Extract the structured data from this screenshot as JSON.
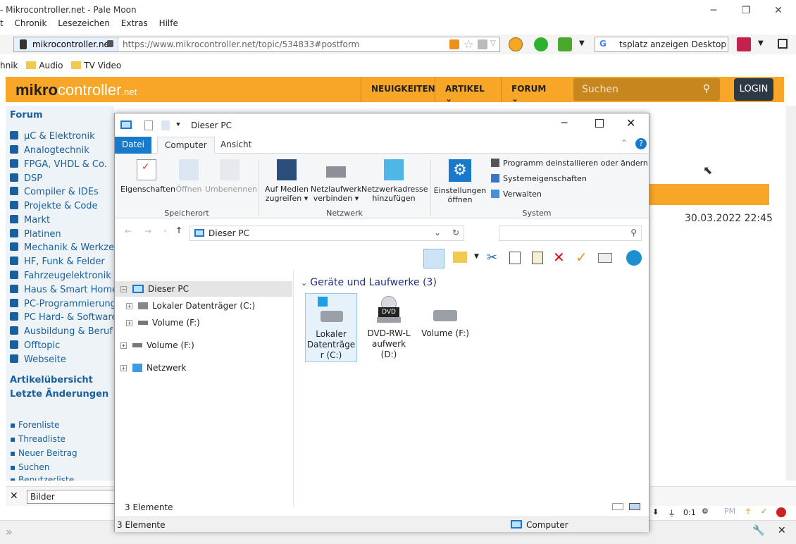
{
  "browser": {
    "title": "- Mikrocontroller.net - Pale Moon",
    "menu": [
      "t",
      "Chronik",
      "Lesezeichen",
      "Extras",
      "Hilfe"
    ],
    "url_site": "mikrocontroller.net",
    "url": "https://www.mikrocontroller.net/topic/534833#postform",
    "search_engine_query": "tsplatz anzeigen Desktop",
    "bookmarks": [
      "hnik",
      "Audio",
      "TV Video"
    ]
  },
  "site": {
    "logo_bold": "mikro",
    "logo_rest": "controller",
    "logo_suffix": ".net",
    "nav": [
      "NEUIGKEITEN",
      "ARTIKEL",
      "FORUM"
    ],
    "search_placeholder": "Suchen",
    "login": "LOGIN",
    "sidebar_heading": "Forum",
    "sidebar_items": [
      "µC & Elektronik",
      "Analogtechnik",
      "FPGA, VHDL & Co.",
      "DSP",
      "Compiler & IDEs",
      "Projekte & Code",
      "Markt",
      "Platinen",
      "Mechanik & Werkzeug",
      "HF, Funk & Felder",
      "Fahrzeugelektronik",
      "Haus & Smart Home",
      "PC-Programmierung",
      "PC Hard- & Software",
      "Ausbildung & Beruf",
      "Offtopic",
      "Webseite"
    ],
    "links": [
      "Artikelübersicht",
      "Letzte Änderungen"
    ],
    "bullets": [
      "Forenliste",
      "Threadliste",
      "Neuer Beitrag",
      "Suchen",
      "Benutzerliste"
    ],
    "post_date": "30.03.2022 22:45",
    "find_value": "Bilder",
    "status_ratio": "0:1"
  },
  "explorer": {
    "title": "Dieser PC",
    "tabs": [
      "Datei",
      "Computer",
      "Ansicht"
    ],
    "ribbon": {
      "eigenschaften": "Eigenschaften",
      "oeffnen": "Öffnen",
      "umbenennen": "Umbenennen",
      "medien_1": "Auf Medien",
      "medien_2": "zugreifen",
      "netzlaufwerk_1": "Netzlaufwerk",
      "netzlaufwerk_2": "verbinden",
      "netzadresse_1": "Netzwerkadresse",
      "netzadresse_2": "hinzufügen",
      "einstellungen_1": "Einstellungen",
      "einstellungen_2": "öffnen",
      "deinstallieren": "Programm deinstallieren oder ändern",
      "systemeigenschaften": "Systemeigenschaften",
      "verwalten": "Verwalten",
      "group_speicherort": "Speicherort",
      "group_netzwerk": "Netzwerk",
      "group_system": "System"
    },
    "address": "Dieser PC",
    "tree": [
      "Dieser PC",
      "Lokaler Datenträger (C:)",
      "Volume (F:)",
      "Volume (F:)",
      "Netzwerk"
    ],
    "group_header": "Geräte und Laufwerke (3)",
    "drives": [
      {
        "l1": "Lokaler",
        "l2": "Datenträge",
        "l3": "r (C:)"
      },
      {
        "l1": "DVD-RW-L",
        "l2": "aufwerk",
        "l3": "(D:)"
      },
      {
        "l1": "Volume (F:)",
        "l2": "",
        "l3": ""
      }
    ],
    "status": "3 Elemente",
    "bottom_left": "3 Elemente",
    "bottom_right": "Computer",
    "dvd_label": "DVD"
  },
  "colors": {
    "accent": "#f8a628",
    "link": "#1a5f9e",
    "win_blue": "#1979ca"
  }
}
